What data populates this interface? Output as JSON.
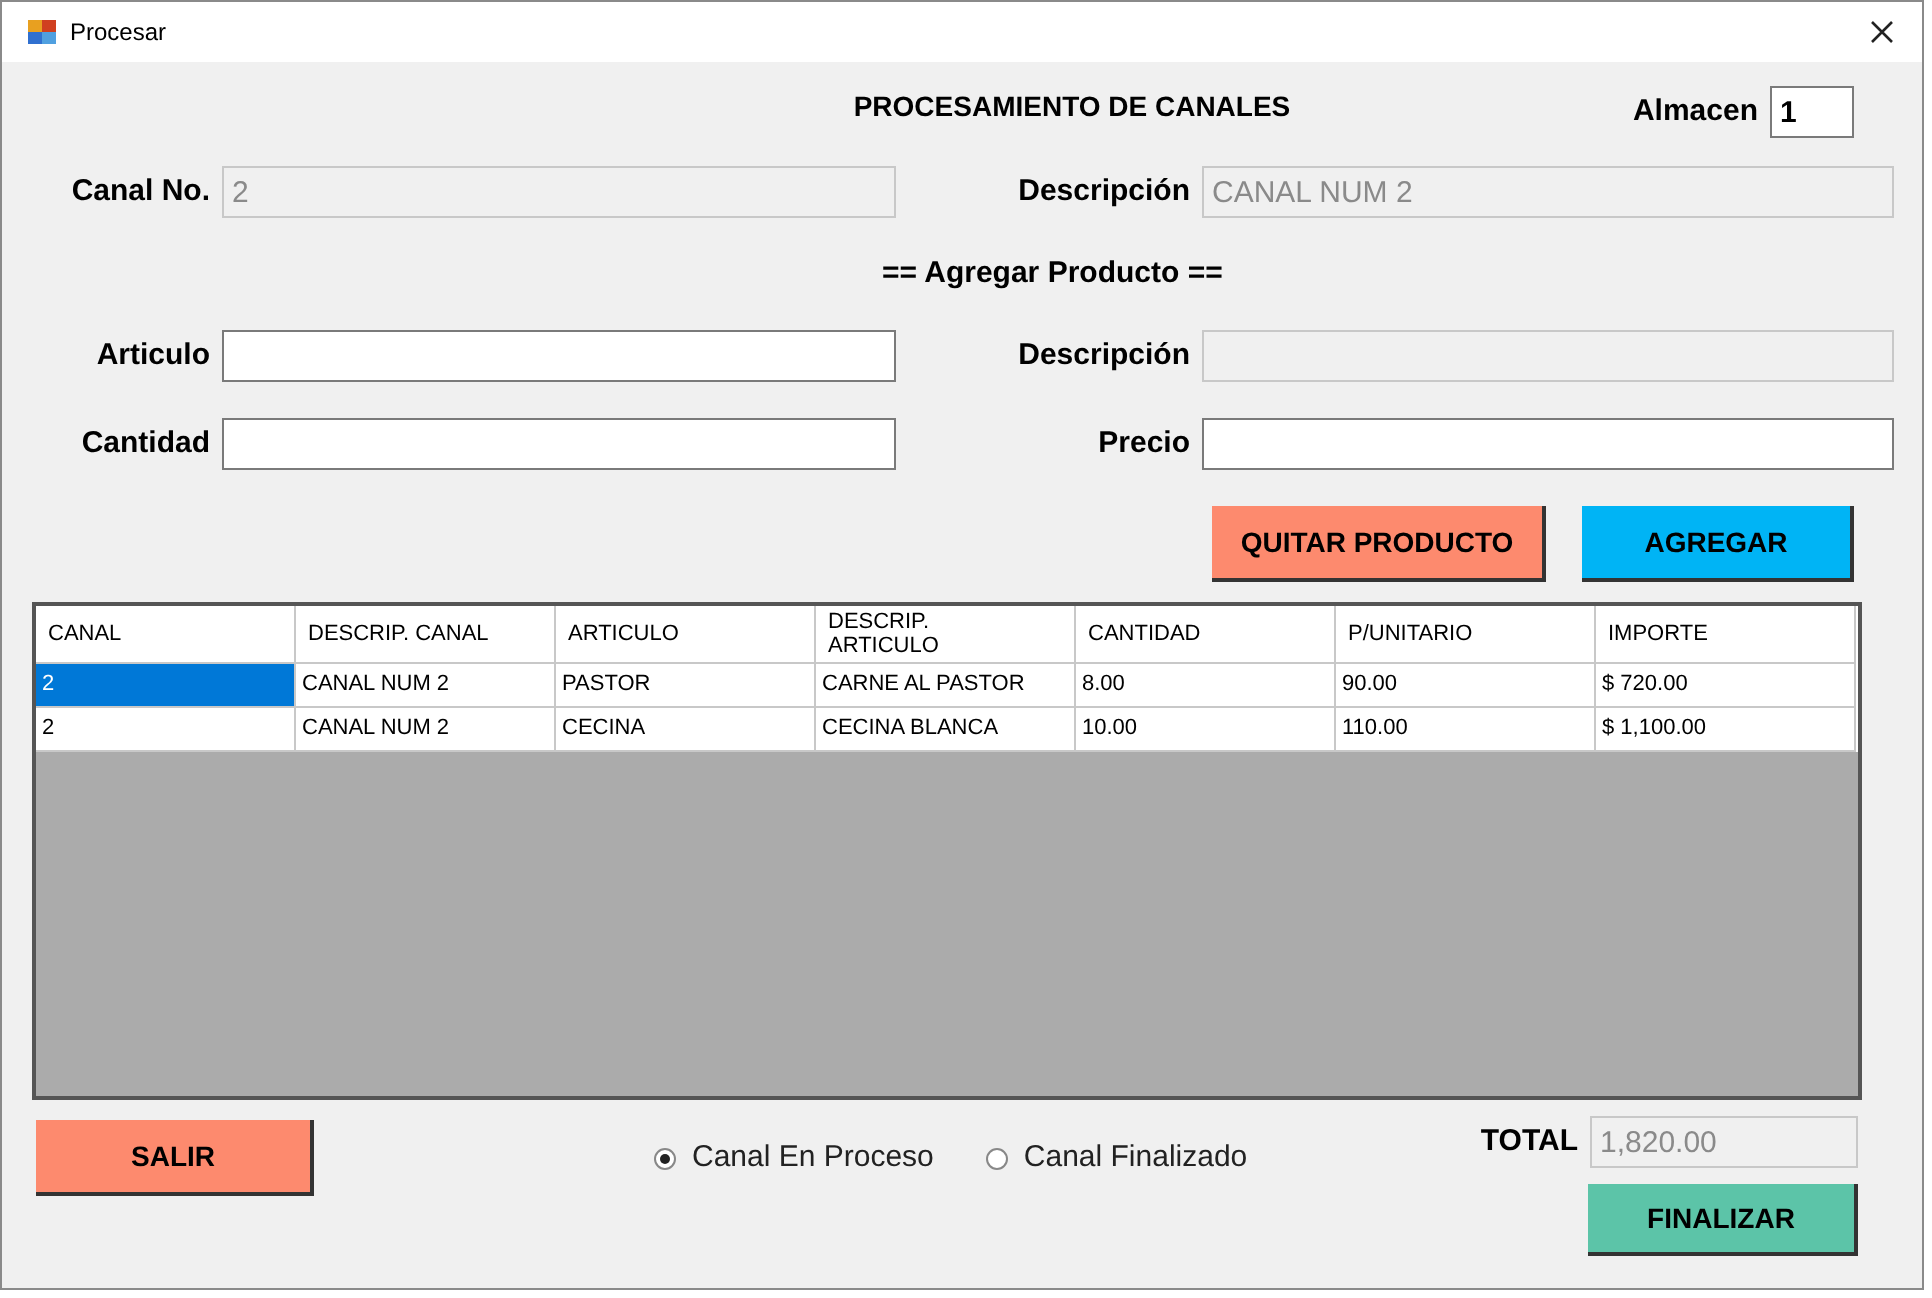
{
  "window": {
    "title": "Procesar"
  },
  "heading": "PROCESAMIENTO DE CANALES",
  "almacen": {
    "label": "Almacen",
    "value": "1"
  },
  "canal": {
    "label": "Canal No.",
    "value": "2",
    "disabled": true
  },
  "canal_descripcion": {
    "label": "Descripción",
    "value": "CANAL NUM 2",
    "disabled": true
  },
  "section_title": "== Agregar Producto ==",
  "articulo": {
    "label": "Articulo",
    "disabled": false
  },
  "articulo_descripcion": {
    "label": "Descripción",
    "disabled": true
  },
  "cantidad": {
    "label": "Cantidad",
    "disabled": false
  },
  "precio": {
    "label": "Precio",
    "disabled": false
  },
  "action_buttons": [
    {
      "label": "QUITAR PRODUCTO",
      "color": "#fd8a6e"
    },
    {
      "label": "AGREGAR",
      "color": "#00b4f5"
    }
  ],
  "table": {
    "columns": [
      "CANAL",
      "DESCRIP. CANAL",
      "ARTICULO",
      "DESCRIP.\nARTICULO",
      "CANTIDAD",
      "P/UNITARIO",
      "IMPORTE"
    ],
    "rows": [
      {
        "selected": true,
        "cells": [
          "2",
          "CANAL NUM 2",
          "PASTOR",
          "CARNE AL PASTOR",
          "8.00",
          "90.00",
          "$ 720.00"
        ]
      },
      {
        "selected": false,
        "cells": [
          "2",
          "CANAL NUM 2",
          "CECINA",
          "CECINA BLANCA",
          "10.00",
          "110.00",
          "$ 1,100.00"
        ]
      }
    ]
  },
  "exit_button": {
    "label": "SALIR"
  },
  "status_options": [
    {
      "label": "Canal En Proceso",
      "selected": true
    },
    {
      "label": "Canal Finalizado",
      "selected": false
    }
  ],
  "total": {
    "label": "TOTAL",
    "value": "1,820.00"
  },
  "finish_button": {
    "label": "FINALIZAR"
  }
}
